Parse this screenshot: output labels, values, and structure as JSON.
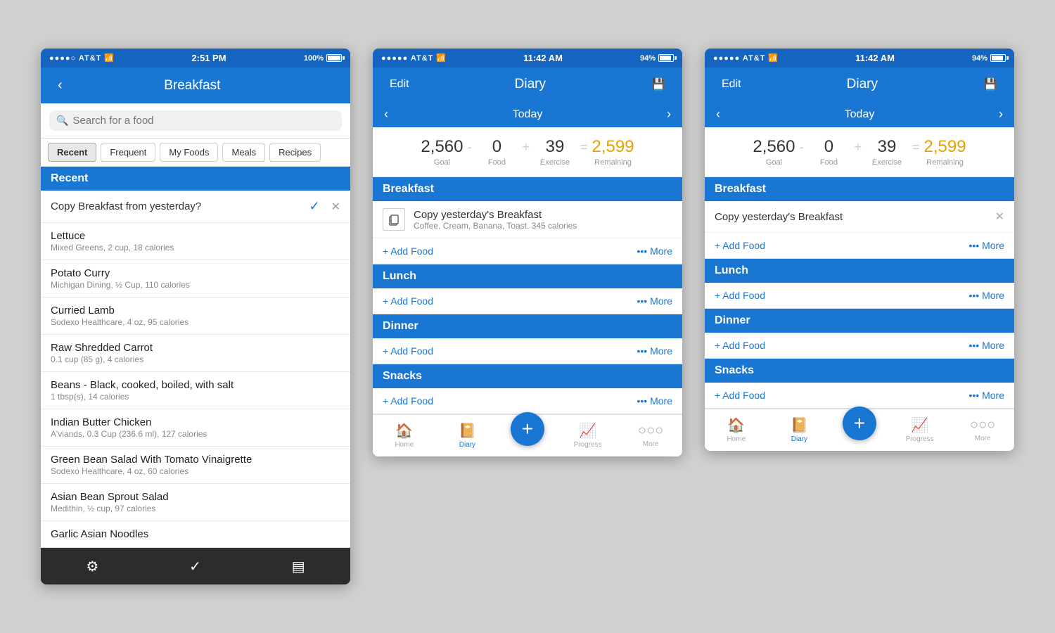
{
  "screens": [
    {
      "id": "breakfast-search",
      "statusBar": {
        "left": "●●●●○ AT&T",
        "wifi": "⊙",
        "time": "2:51 PM",
        "battery": "100%"
      },
      "header": {
        "backLabel": "‹",
        "title": "Breakfast"
      },
      "search": {
        "placeholder": "Search for a food"
      },
      "filterTabs": [
        "Recent",
        "Frequent",
        "My Foods",
        "Meals",
        "Recipes"
      ],
      "activeTab": "Recent",
      "sectionLabel": "Recent",
      "copyRow": {
        "text": "Copy Breakfast from yesterday?",
        "checkSymbol": "✓",
        "xSymbol": "✕"
      },
      "foodItems": [
        {
          "name": "Lettuce",
          "detail": "Mixed Greens, 2 cup, 18 calories"
        },
        {
          "name": "Potato Curry",
          "detail": "Michigan Dining, ½ Cup, 110 calories"
        },
        {
          "name": "Curried Lamb",
          "detail": "Sodexo Healthcare, 4 oz, 95 calories"
        },
        {
          "name": "Raw Shredded Carrot",
          "detail": "0.1 cup (85 g), 4 calories"
        },
        {
          "name": "Beans - Black, cooked, boiled, with salt",
          "detail": "1 tbsp(s), 14 calories"
        },
        {
          "name": "Indian Butter Chicken",
          "detail": "A'viands, 0.3 Cup (236.6 ml), 127 calories"
        },
        {
          "name": "Green Bean Salad With Tomato Vinaigrette",
          "detail": "Sodexo Healthcare, 4 oz, 60 calories"
        },
        {
          "name": "Asian Bean Sprout Salad",
          "detail": "Medithin, ½ cup, 97 calories"
        },
        {
          "name": "Garlic Asian Noodles",
          "detail": ""
        }
      ],
      "toolbar": {
        "items": [
          "⚙",
          "✓",
          "▤"
        ]
      }
    },
    {
      "id": "diary-1",
      "statusBar": {
        "left": "●●●●● AT&T",
        "wifi": "⊙",
        "time": "11:42 AM",
        "battery": "94%"
      },
      "header": {
        "editLabel": "Edit",
        "title": "Diary",
        "saveIcon": "💾"
      },
      "nav": {
        "prevArrow": "‹",
        "title": "Today",
        "nextArrow": "›"
      },
      "calories": {
        "goal": "2,560",
        "goalLabel": "Goal",
        "op1": "-",
        "food": "0",
        "foodLabel": "Food",
        "op2": "+",
        "exercise": "39",
        "exerciseLabel": "Exercise",
        "eq": "=",
        "remaining": "2,599",
        "remainingLabel": "Remaining"
      },
      "meals": [
        {
          "name": "Breakfast",
          "copyYesterday": {
            "title": "Copy yesterday's Breakfast",
            "subtitle": "Coffee, Cream, Banana, Toast. 345 calories",
            "hasIcon": true
          },
          "addFoodLabel": "+ Add Food",
          "moreLabel": "••• More"
        },
        {
          "name": "Lunch",
          "copyYesterday": null,
          "addFoodLabel": "+ Add Food",
          "moreLabel": "••• More"
        },
        {
          "name": "Dinner",
          "copyYesterday": null,
          "addFoodLabel": "+ Add Food",
          "moreLabel": "••• More"
        },
        {
          "name": "Snacks",
          "copyYesterday": null,
          "addFoodLabel": "+ Add Food",
          "moreLabel": "••• More"
        }
      ],
      "bottomNav": {
        "items": [
          {
            "icon": "🏠",
            "label": "Home",
            "active": false
          },
          {
            "icon": "📔",
            "label": "Diary",
            "active": true
          },
          {
            "add": true
          },
          {
            "icon": "📈",
            "label": "Progress",
            "active": false
          },
          {
            "icon": "○○○",
            "label": "More",
            "active": false
          }
        ]
      }
    },
    {
      "id": "diary-2",
      "statusBar": {
        "left": "●●●●● AT&T",
        "wifi": "⊙",
        "time": "11:42 AM",
        "battery": "94%"
      },
      "header": {
        "editLabel": "Edit",
        "title": "Diary",
        "saveIcon": "💾"
      },
      "nav": {
        "prevArrow": "‹",
        "title": "Today",
        "nextArrow": "›"
      },
      "calories": {
        "goal": "2,560",
        "goalLabel": "Goal",
        "op1": "-",
        "food": "0",
        "foodLabel": "Food",
        "op2": "+",
        "exercise": "39",
        "exerciseLabel": "Exercise",
        "eq": "=",
        "remaining": "2,599",
        "remainingLabel": "Remaining"
      },
      "meals": [
        {
          "name": "Breakfast",
          "copyYesterdayText": "Copy yesterday's Breakfast",
          "hasDismiss": true,
          "addFoodLabel": "+ Add Food",
          "moreLabel": "••• More"
        },
        {
          "name": "Lunch",
          "copyYesterdayText": null,
          "hasDismiss": false,
          "addFoodLabel": "+ Add Food",
          "moreLabel": "••• More"
        },
        {
          "name": "Dinner",
          "copyYesterdayText": null,
          "hasDismiss": false,
          "addFoodLabel": "+ Add Food",
          "moreLabel": "••• More"
        },
        {
          "name": "Snacks",
          "copyYesterdayText": null,
          "hasDismiss": false,
          "addFoodLabel": "+ Add Food",
          "moreLabel": "••• More"
        }
      ],
      "bottomNav": {
        "items": [
          {
            "icon": "🏠",
            "label": "Home",
            "active": false
          },
          {
            "icon": "📔",
            "label": "Diary",
            "active": true
          },
          {
            "add": true
          },
          {
            "icon": "📈",
            "label": "Progress",
            "active": false
          },
          {
            "icon": "○○○",
            "label": "More",
            "active": false
          }
        ]
      }
    }
  ]
}
